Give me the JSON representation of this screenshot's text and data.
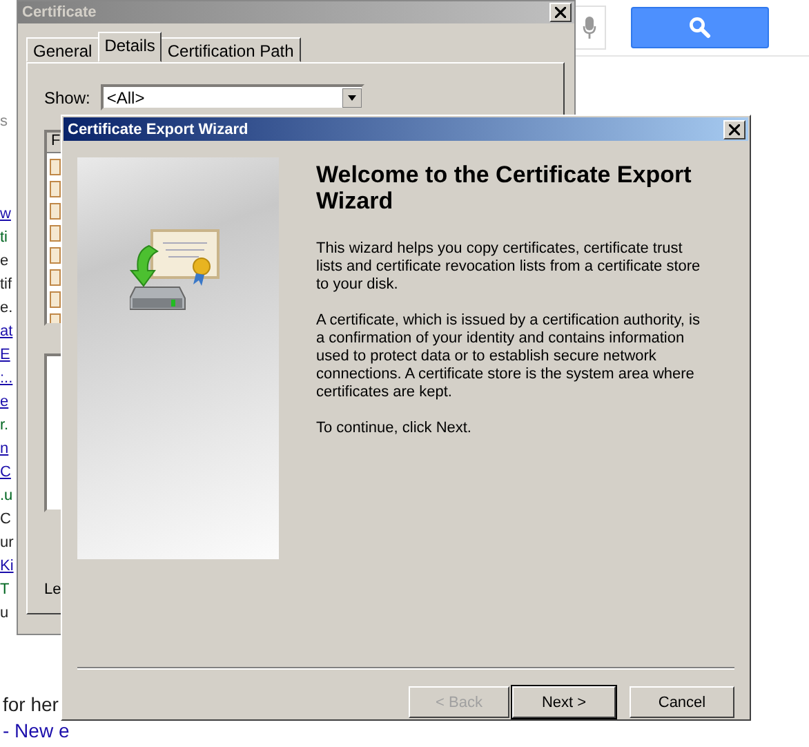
{
  "background_page": {
    "fragments": [
      {
        "text": "w",
        "kind": "link"
      },
      {
        "text": "ti",
        "kind": "url"
      },
      {
        "text": "e",
        "kind": "text"
      },
      {
        "text": "tif",
        "kind": "text"
      },
      {
        "text": "e.",
        "kind": "text"
      },
      {
        "text": "at",
        "kind": "link"
      },
      {
        "text": "E",
        "kind": "link"
      },
      {
        "text": ":..",
        "kind": "link"
      },
      {
        "text": "e",
        "kind": "link"
      },
      {
        "text": "r.",
        "kind": "url"
      },
      {
        "text": "n",
        "kind": "link"
      },
      {
        "text": "C",
        "kind": "link"
      },
      {
        "text": ".u",
        "kind": "url"
      },
      {
        "text": "C",
        "kind": "text"
      },
      {
        "text": "ur",
        "kind": "text"
      },
      {
        "text": "Ki",
        "kind": "link"
      },
      {
        "text": "T",
        "kind": "url"
      },
      {
        "text": "u",
        "kind": "text"
      }
    ],
    "top_fragment": "s",
    "bottom_lines": [
      {
        "text": "for her",
        "kind": "text"
      },
      {
        "text": "- New e",
        "kind": "link"
      }
    ]
  },
  "certificate_window": {
    "title": "Certificate",
    "tabs": [
      {
        "label": "General",
        "selected": false
      },
      {
        "label": "Details",
        "selected": true
      },
      {
        "label": "Certification Path",
        "selected": false
      }
    ],
    "show_label": "Show:",
    "show_value": "<All>",
    "list_header": "F",
    "bottom_label": "Le"
  },
  "wizard": {
    "title": "Certificate Export Wizard",
    "heading": "Welcome to the Certificate Export Wizard",
    "paragraphs": [
      "This wizard helps you copy certificates, certificate trust lists and certificate revocation lists from a certificate store to your disk.",
      "A certificate, which is issued by a certification authority, is a confirmation of your identity and contains information used to protect data or to establish secure network connections. A certificate store is the system area where certificates are kept.",
      "To continue, click Next."
    ],
    "buttons": [
      {
        "label": "< Back",
        "disabled": true,
        "default": false
      },
      {
        "label": "Next >",
        "disabled": false,
        "default": true
      },
      {
        "label": "Cancel",
        "disabled": false,
        "default": false
      }
    ]
  }
}
